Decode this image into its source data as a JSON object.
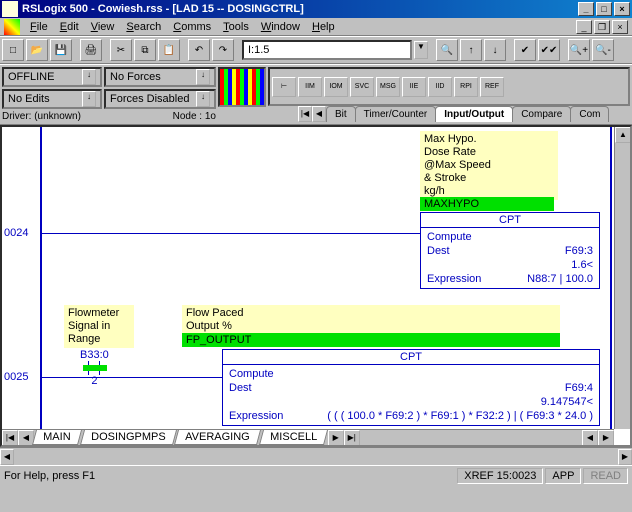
{
  "title": "RSLogix 500 - Cowiesh.rss - [LAD 15 -- DOSINGCTRL]",
  "menus": [
    "File",
    "Edit",
    "View",
    "Search",
    "Comms",
    "Tools",
    "Window",
    "Help"
  ],
  "address": "I:1.5",
  "status": {
    "mode": "OFFLINE",
    "edits": "No Edits",
    "forces": "No Forces",
    "forces_disabled": "Forces Disabled",
    "driver": "Driver: (unknown)",
    "node": "Node : 1o"
  },
  "io_buttons": [
    "IIM",
    "IOM",
    "SVC",
    "MSG",
    "IIE",
    "IID",
    "RPI",
    "REF"
  ],
  "type_tabs": [
    "Bit",
    "Timer/Counter",
    "Input/Output",
    "Compare",
    "Com"
  ],
  "active_type_tab": 2,
  "rungs": [
    {
      "num": "0024",
      "comment_lines": [
        "Max Hypo.",
        "Dose Rate",
        "@Max Speed",
        "& Stroke",
        "kg/h"
      ],
      "tag": "MAXHYPO",
      "cpt": {
        "label": "CPT",
        "title": "Compute",
        "dest_label": "Dest",
        "dest_val": "F69:3",
        "dest_val2": "1.6<",
        "expr_label": "Expression",
        "expr_val": "N88:7 | 100.0"
      }
    },
    {
      "num": "0025",
      "side_comment": [
        "Flowmeter",
        "Signal in",
        "Range"
      ],
      "contact_addr": "B33:0",
      "contact_bit": "2",
      "out_comment": [
        "Flow Paced",
        "Output %"
      ],
      "tag": "FP_OUTPUT",
      "cpt": {
        "label": "CPT",
        "title": "Compute",
        "dest_label": "Dest",
        "dest_val": "F69:4",
        "dest_val2": "9.147547<",
        "expr_label": "Expression",
        "expr_val": "( ( ( 100.0 * F69:2 ) * F69:1 ) * F32:2 ) | ( F69:3 * 24.0 )"
      }
    }
  ],
  "bottom_tabs": [
    "MAIN",
    "DOSINGPMPS",
    "AVERAGING",
    "MISCELL"
  ],
  "statusbar": {
    "help": "For Help, press F1",
    "xref": "XREF",
    "xref_val": "15:0023",
    "app": "APP",
    "read": "READ"
  }
}
